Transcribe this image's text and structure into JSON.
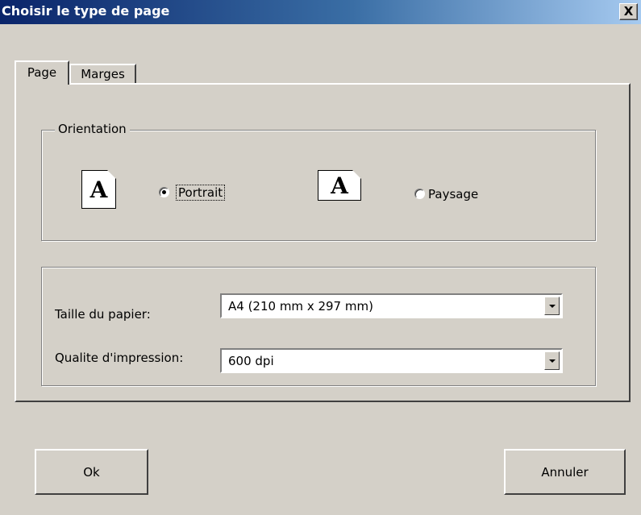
{
  "window": {
    "title": "Choisir le type de page",
    "close_label": "X"
  },
  "tabs": [
    {
      "label": "Page",
      "active": true
    },
    {
      "label": "Marges",
      "active": false
    }
  ],
  "orientation": {
    "legend": "Orientation",
    "icon_glyph": "A",
    "portrait": {
      "label": "Portrait",
      "selected": true,
      "icon": "portrait-page-icon"
    },
    "paysage": {
      "label": "Paysage",
      "selected": false,
      "icon": "landscape-page-icon"
    }
  },
  "paper": {
    "size_label": "Taille du papier:",
    "size_value": "A4 (210 mm x 297 mm)",
    "quality_label": "Qualite d'impression:",
    "quality_value": "600 dpi"
  },
  "buttons": {
    "ok": "Ok",
    "cancel": "Annuler"
  },
  "colors": {
    "titlebar_start": "#0a246a",
    "titlebar_end": "#a6caf0",
    "face": "#d4d0c8"
  }
}
